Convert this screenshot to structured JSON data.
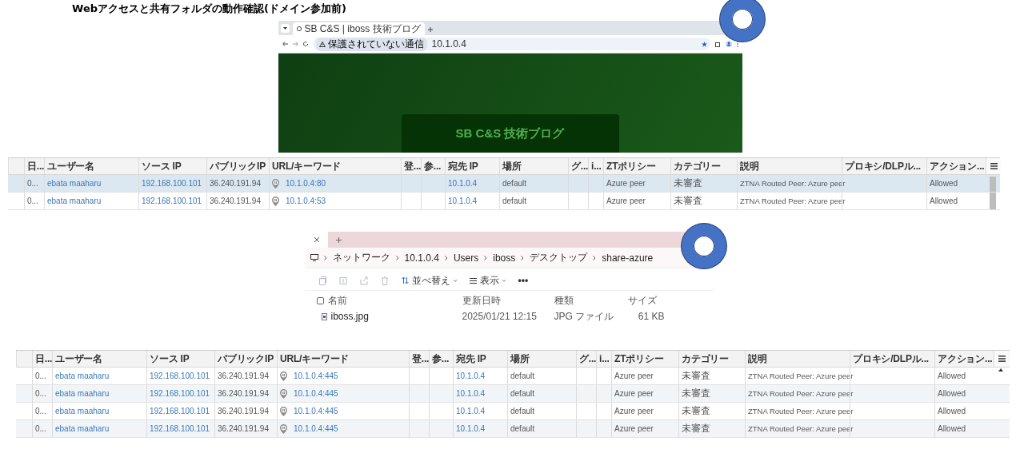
{
  "title": "Webアクセスと共有フォルダの動作確認(ドメイン参加前)",
  "browser": {
    "tab_title": "SB C&S | iboss 技術ブログ",
    "security_label": "保護されていない通信",
    "address": "10.1.0.4",
    "page_heading": "SB C&S 技術ブログ"
  },
  "log_table_1": {
    "columns": [
      "日...",
      "ユーザー名",
      "ソース IP",
      "パブリックIP",
      "URL/キーワード",
      "登...",
      "参...",
      "宛先 IP",
      "場所",
      "グ...",
      "i...",
      "ZTポリシー",
      "カテゴリー",
      "説明",
      "プロキシ/DLPル...",
      "アクション..."
    ],
    "rows": [
      {
        "selected": true,
        "date": "0...",
        "user": "ebata maaharu",
        "source_ip": "192.168.100.101",
        "public_ip": "36.240.191.94",
        "url": "10.1.0.4:80",
        "dest_ip": "10.1.0.4",
        "location": "default",
        "zt_policy": "Azure peer",
        "category": "未審査",
        "description": "ZTNA Routed Peer: Azure peer",
        "action": "Allowed"
      },
      {
        "selected": false,
        "date": "0...",
        "user": "ebata maaharu",
        "source_ip": "192.168.100.101",
        "public_ip": "36.240.191.94",
        "url": "10.1.0.4:53",
        "dest_ip": "10.1.0.4",
        "location": "default",
        "zt_policy": "Azure peer",
        "category": "未審査",
        "description": "ZTNA Routed Peer: Azure peer",
        "action": "Allowed"
      }
    ]
  },
  "explorer": {
    "breadcrumb": [
      "ネットワーク",
      "10.1.0.4",
      "Users",
      "iboss",
      "デスクトップ",
      "share-azure"
    ],
    "sort_label": "並べ替え",
    "view_label": "表示",
    "more_label": "•••",
    "select_all_checked": false,
    "columns": [
      "名前",
      "更新日時",
      "種類",
      "サイズ"
    ],
    "files": [
      {
        "name": "iboss.jpg",
        "modified": "2025/01/21 12:15",
        "type": "JPG ファイル",
        "size": "61 KB"
      }
    ]
  },
  "log_table_2": {
    "columns": [
      "日...",
      "ユーザー名",
      "ソース IP",
      "パブリックIP",
      "URL/キーワード",
      "登...",
      "参...",
      "宛先 IP",
      "場所",
      "グ...",
      "i...",
      "ZTポリシー",
      "カテゴリー",
      "説明",
      "プロキシ/DLPル...",
      "アクション..."
    ],
    "rows": [
      {
        "date": "0...",
        "user": "ebata maaharu",
        "source_ip": "192.168.100.101",
        "public_ip": "36.240.191.94",
        "url": "10.1.0.4:445",
        "dest_ip": "10.1.0.4",
        "location": "default",
        "zt_policy": "Azure peer",
        "category": "未審査",
        "description": "ZTNA Routed Peer: Azure peer",
        "action": "Allowed"
      },
      {
        "date": "0...",
        "user": "ebata maaharu",
        "source_ip": "192.168.100.101",
        "public_ip": "36.240.191.94",
        "url": "10.1.0.4:445",
        "dest_ip": "10.1.0.4",
        "location": "default",
        "zt_policy": "Azure peer",
        "category": "未審査",
        "description": "ZTNA Routed Peer: Azure peer",
        "action": "Allowed"
      },
      {
        "date": "0...",
        "user": "ebata maaharu",
        "source_ip": "192.168.100.101",
        "public_ip": "36.240.191.94",
        "url": "10.1.0.4:445",
        "dest_ip": "10.1.0.4",
        "location": "default",
        "zt_policy": "Azure peer",
        "category": "未審査",
        "description": "ZTNA Routed Peer: Azure peer",
        "action": "Allowed"
      },
      {
        "date": "0...",
        "user": "ebata maaharu",
        "source_ip": "192.168.100.101",
        "public_ip": "36.240.191.94",
        "url": "10.1.0.4:445",
        "dest_ip": "10.1.0.4",
        "location": "default",
        "zt_policy": "Azure peer",
        "category": "未審査",
        "description": "ZTNA Routed Peer: Azure peer",
        "action": "Allowed"
      }
    ]
  }
}
